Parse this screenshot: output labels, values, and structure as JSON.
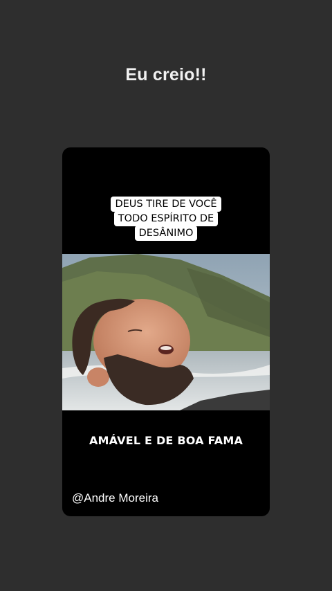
{
  "story": {
    "caption": "Eu creio!!"
  },
  "video": {
    "top_label_lines": [
      "DEUS TIRE DE VOCÊ",
      "TODO ESPÍRITO DE",
      "DESÂNIMO"
    ],
    "bottom_text": "AMÁVEL E DE BOA FAMA",
    "watermark": "@Andre Moreira"
  },
  "colors": {
    "background": "#2e2e2e",
    "card": "#000000",
    "label_bg": "#ffffff",
    "text": "#ffffff"
  }
}
